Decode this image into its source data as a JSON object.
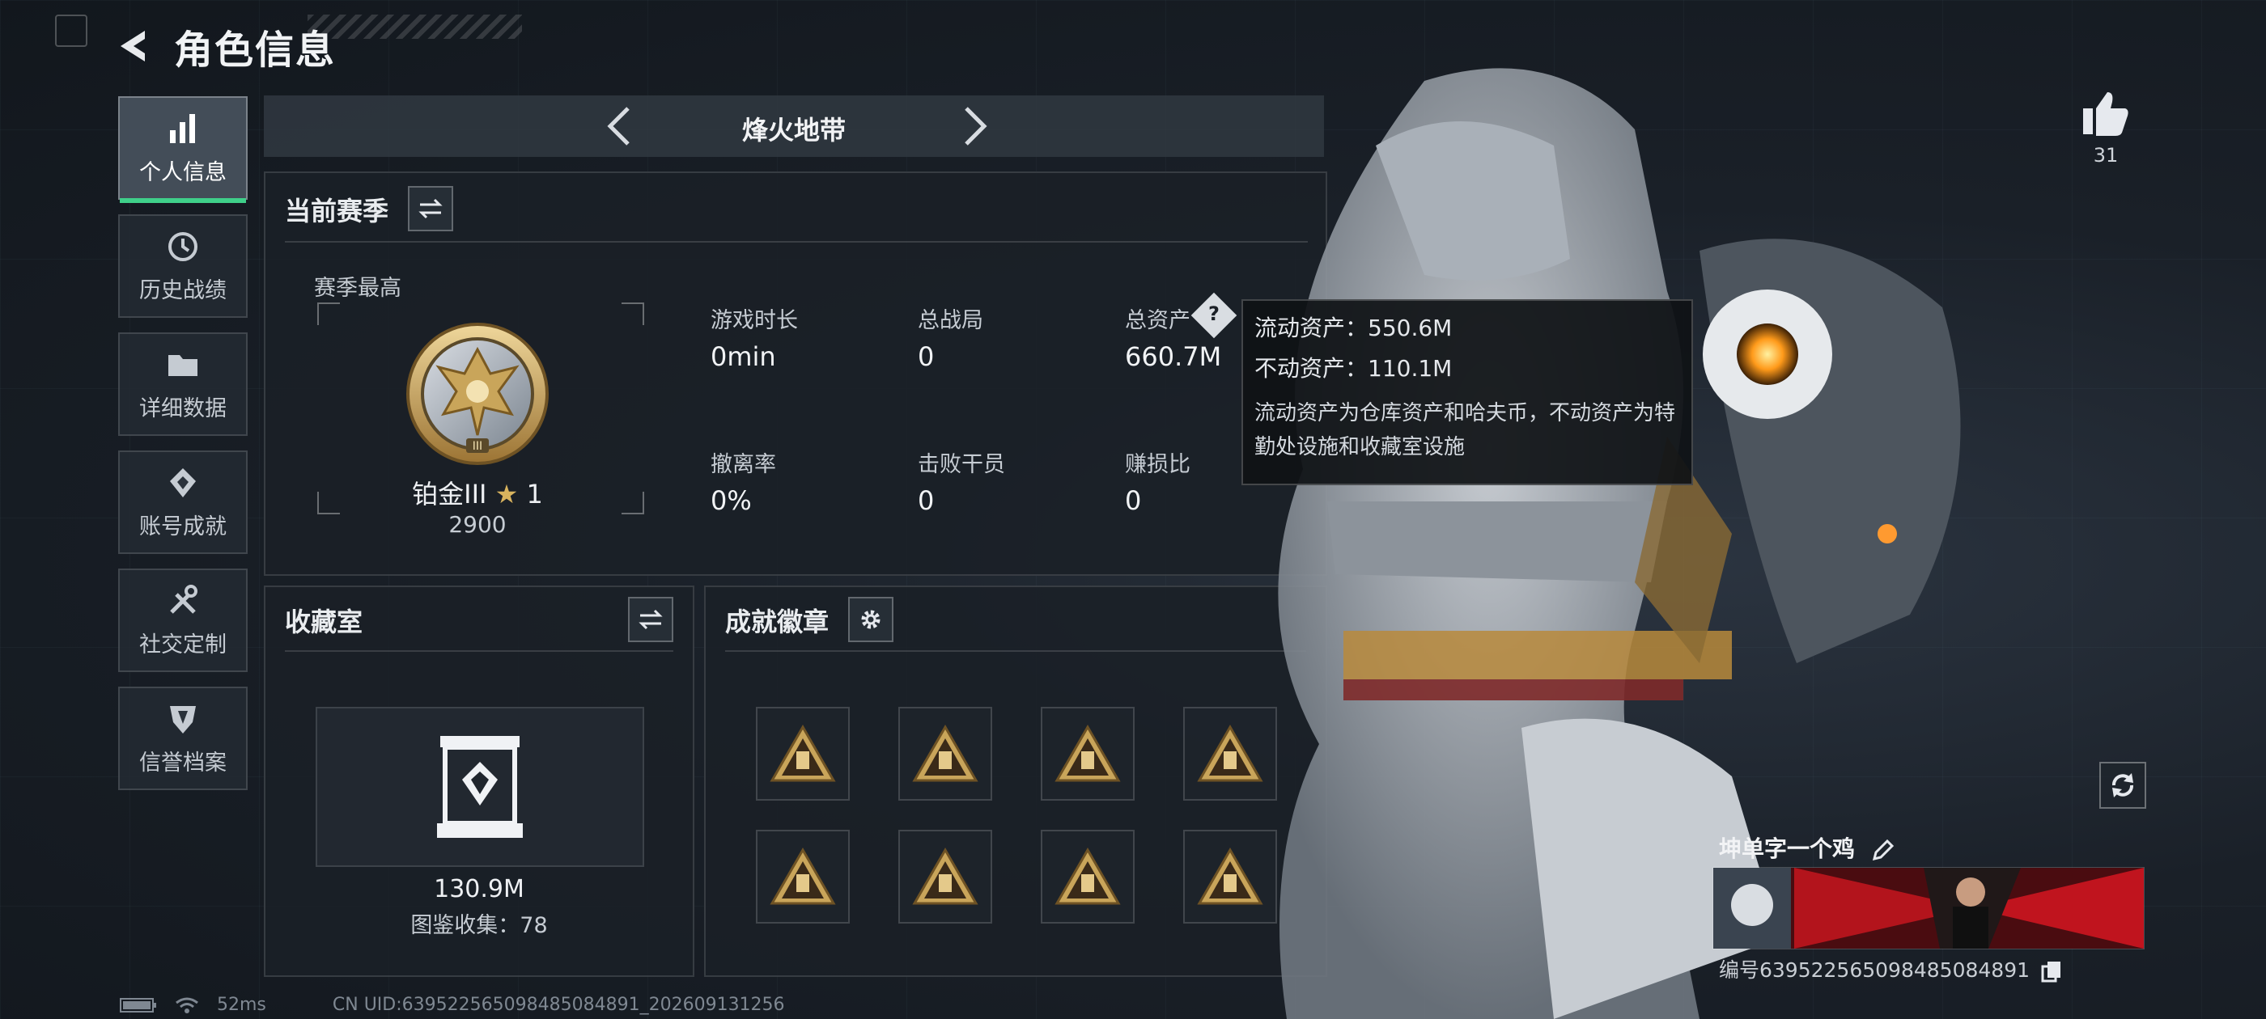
{
  "header": {
    "title": "角色信息"
  },
  "sidebar": {
    "items": [
      {
        "label": "个人信息",
        "icon": "bar-chart-icon",
        "active": true
      },
      {
        "label": "历史战绩",
        "icon": "history-icon",
        "active": false
      },
      {
        "label": "详细数据",
        "icon": "folder-icon",
        "active": false
      },
      {
        "label": "账号成就",
        "icon": "achievement-icon",
        "active": false
      },
      {
        "label": "社交定制",
        "icon": "tools-icon",
        "active": false
      },
      {
        "label": "信誉档案",
        "icon": "shield-icon",
        "active": false
      }
    ]
  },
  "mode_nav": {
    "title": "烽火地带"
  },
  "season": {
    "title": "当前赛季",
    "best_label": "赛季最高",
    "rank_name": "铂金III",
    "rank_stars": "1",
    "rank_score": "2900",
    "stats": [
      {
        "label": "游戏时长",
        "value": "0min"
      },
      {
        "label": "总战局",
        "value": "0"
      },
      {
        "label": "总资产",
        "value": "660.7M"
      },
      {
        "label": "撤离率",
        "value": "0%"
      },
      {
        "label": "击败干员",
        "value": "0"
      },
      {
        "label": "赚损比",
        "value": "0"
      }
    ]
  },
  "tooltip": {
    "liquid": "流动资产：550.6M",
    "fixed": "不动资产：110.1M",
    "desc": "流动资产为仓库资产和哈夫币，不动资产为特勤处设施和收藏室设施"
  },
  "collection": {
    "title": "收藏室",
    "value": "130.9M",
    "catalog": "图鉴收集：78"
  },
  "badges": {
    "title": "成就徽章",
    "items": [
      "badge-icon",
      "badge-icon",
      "badge-icon",
      "badge-icon",
      "badge-icon",
      "badge-icon",
      "badge-icon",
      "badge-icon"
    ]
  },
  "profile": {
    "likes": "31",
    "name": "坤单字一个鸡",
    "uid": "编号639522565098485084891"
  },
  "status_bar": {
    "ping": "52ms",
    "cn_uid": "CN UID:639522565098485084891_202609131256"
  },
  "colors": {
    "accent": "#3fd08a",
    "gold": "#c9a55a",
    "panel": "#1a2027"
  }
}
